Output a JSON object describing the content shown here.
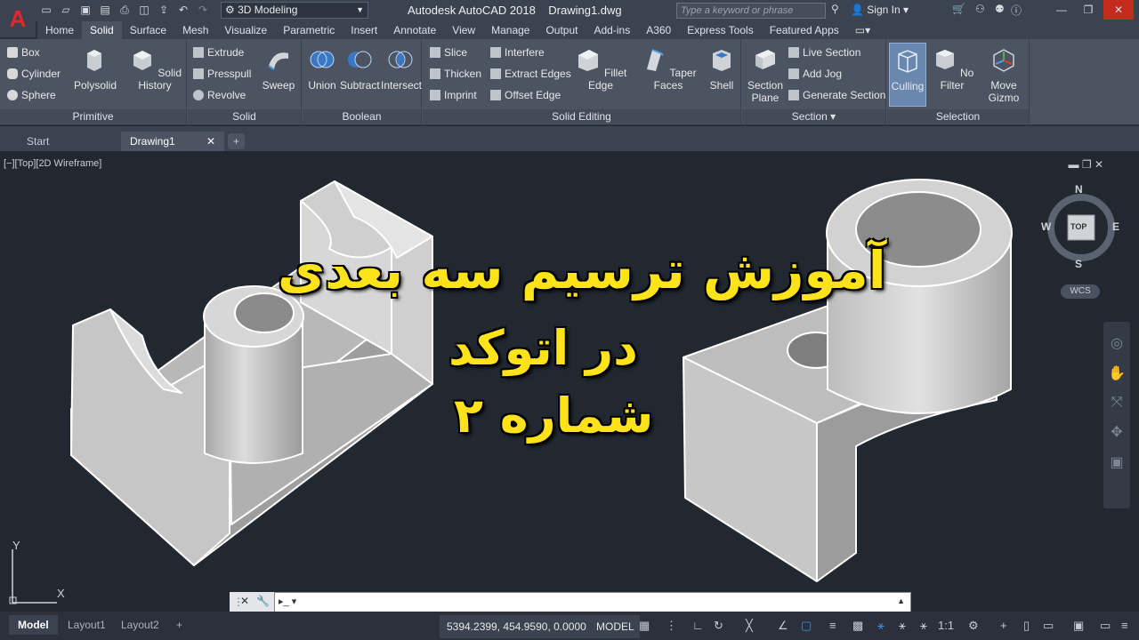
{
  "app": {
    "logo_letter": "A",
    "workspace": "3D Modeling",
    "title": "Autodesk AutoCAD 2018    Drawing1.dwg",
    "search_placeholder": "Type a keyword or phrase",
    "sign_in": "Sign In"
  },
  "ribbon_tabs": [
    "Home",
    "Solid",
    "Surface",
    "Mesh",
    "Visualize",
    "Parametric",
    "Insert",
    "Annotate",
    "View",
    "Manage",
    "Output",
    "Add-ins",
    "A360",
    "Express Tools",
    "Featured Apps"
  ],
  "active_tab": "Solid",
  "panels": {
    "primitive": {
      "title": "Primitive",
      "small": [
        "Box",
        "Cylinder",
        "Sphere"
      ],
      "big": [
        "Polysolid",
        "Solid History"
      ]
    },
    "solid": {
      "title": "Solid",
      "small": [
        "Extrude",
        "Presspull",
        "Revolve"
      ],
      "big": [
        "Sweep"
      ]
    },
    "boolean": {
      "title": "Boolean",
      "big": [
        "Union",
        "Subtract",
        "Intersect"
      ]
    },
    "solid_editing": {
      "title": "Solid Editing",
      "col1": [
        "Slice",
        "Thicken",
        "Imprint"
      ],
      "col2": [
        "Interfere",
        "Extract Edges",
        "Offset Edge"
      ],
      "big": [
        "Fillet Edge",
        "Taper Faces",
        "Shell"
      ]
    },
    "section": {
      "title": "Section",
      "big": [
        "Section Plane"
      ],
      "small": [
        "Live Section",
        "Add Jog",
        "Generate Section"
      ]
    },
    "selection": {
      "title": "Selection",
      "big": [
        "Culling",
        "No Filter",
        "Move Gizmo"
      ]
    }
  },
  "doc_tabs": [
    "Start",
    "Drawing1"
  ],
  "viewport_label": "[−][Top][2D Wireframe]",
  "overlay": {
    "line1": "آموزش ترسیم سه بعدی",
    "line2": "در اتوکد",
    "line3": "شماره ۲"
  },
  "viewcube": {
    "n": "N",
    "s": "S",
    "e": "E",
    "w": "W",
    "face": "TOP",
    "wcs": "WCS"
  },
  "ucs": {
    "x": "X",
    "y": "Y"
  },
  "layout_tabs": [
    "Model",
    "Layout1",
    "Layout2"
  ],
  "status": {
    "coords": "5394.2399, 454.9590, 0.0000",
    "model": "MODEL",
    "scale": "1:1"
  }
}
